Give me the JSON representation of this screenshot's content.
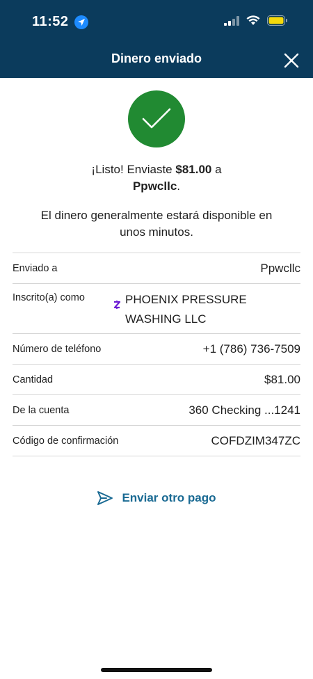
{
  "status_bar": {
    "time": "11:52"
  },
  "header": {
    "title": "Dinero enviado"
  },
  "confirmation": {
    "line_prefix": "¡Listo! Enviaste ",
    "amount": "$81.00",
    "line_mid": " a",
    "recipient": "Ppwcllc",
    "line_end": ".",
    "availability": "El dinero generalmente estará disponible en unos minutos."
  },
  "details": {
    "sent_to": {
      "label": "Enviado a",
      "value": "Ppwcllc"
    },
    "enrolled_as": {
      "label": "Inscrito(a) como",
      "value": "PHOENIX PRESSURE WASHING LLC",
      "icon": "zelle-icon"
    },
    "phone": {
      "label": "Número de teléfono",
      "value": "+1 (786) 736-7509"
    },
    "amount": {
      "label": "Cantidad",
      "value": "$81.00"
    },
    "from_account": {
      "label": "De la cuenta",
      "value": "360 Checking ...1241"
    },
    "confirmation_code": {
      "label": "Código de confirmación",
      "value": "COFDZIM347ZC"
    }
  },
  "actions": {
    "send_another": "Enviar otro pago"
  },
  "colors": {
    "header_bg": "#0b3b5c",
    "success_green": "#218a32",
    "link_blue": "#1a6a93",
    "zelle_purple": "#6d1ed4"
  }
}
